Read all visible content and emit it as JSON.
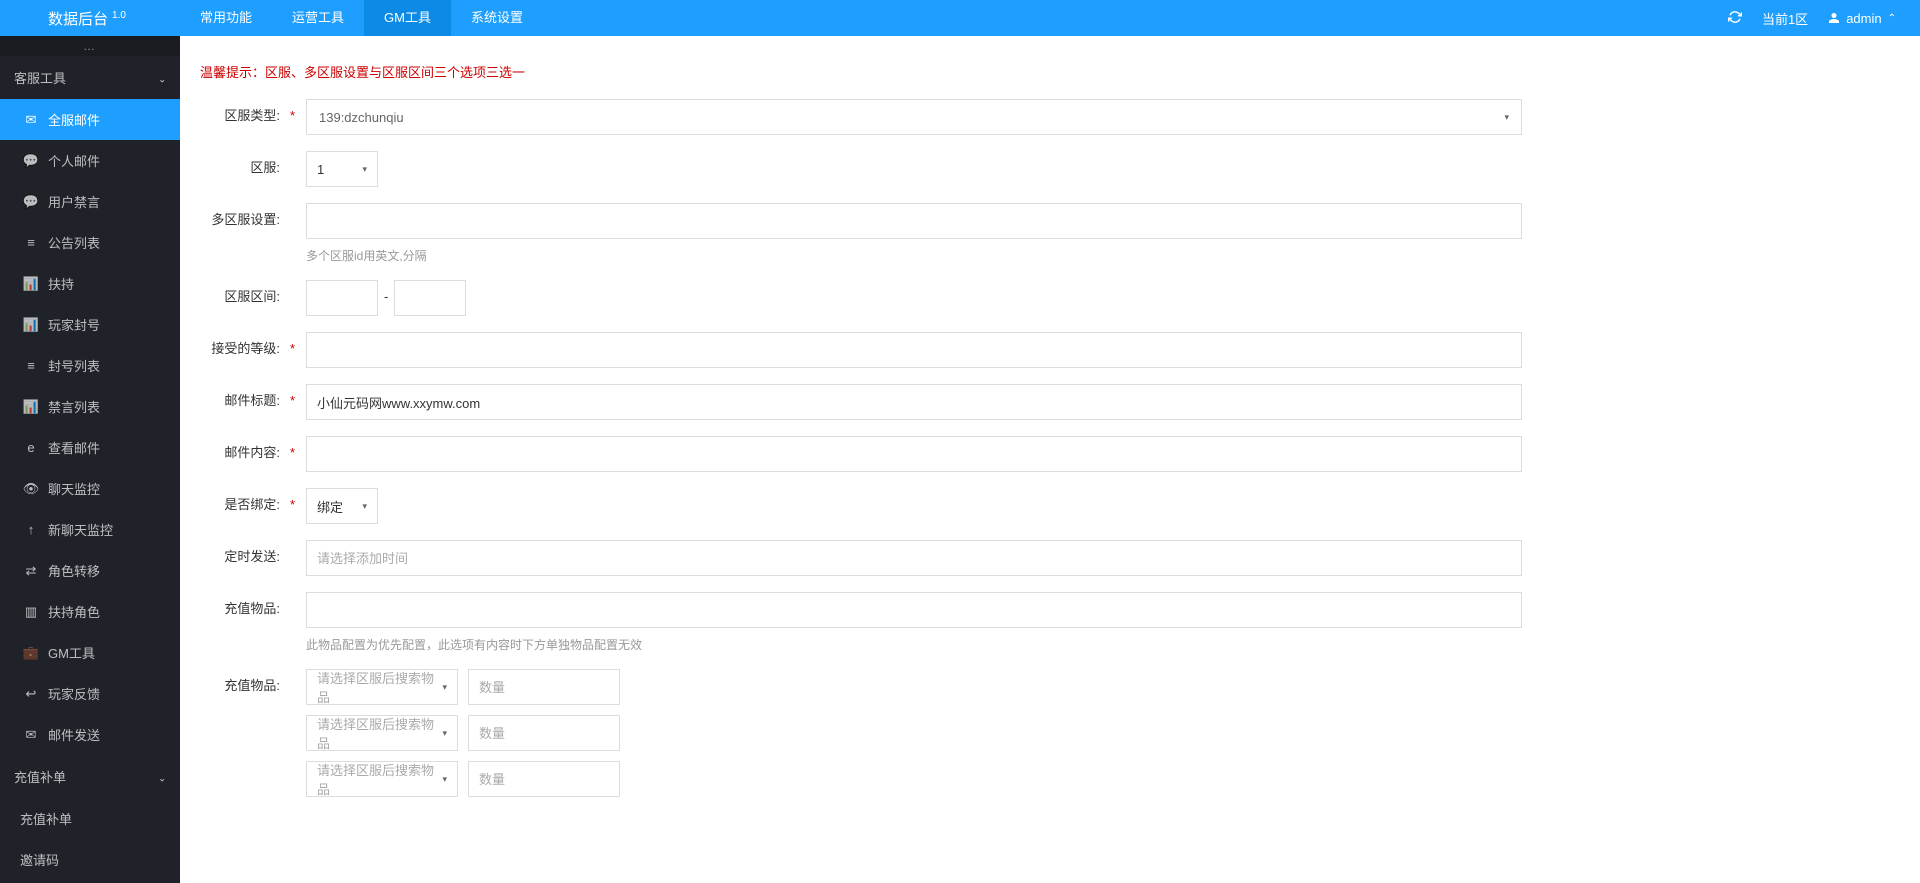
{
  "header": {
    "title": "数据后台",
    "version": "1.0",
    "nav": [
      "常用功能",
      "运营工具",
      "GM工具",
      "系统设置"
    ],
    "active_nav": 2,
    "current_zone_label": "当前1区",
    "user": "admin"
  },
  "sidebar": {
    "collapse_dots": "…",
    "groups": [
      {
        "title": "客服工具",
        "expanded": true,
        "items": [
          {
            "icon": "✉",
            "label": "全服邮件",
            "active": true
          },
          {
            "icon": "💬",
            "label": "个人邮件"
          },
          {
            "icon": "💬",
            "label": "用户禁言"
          },
          {
            "icon": "≡",
            "label": "公告列表"
          },
          {
            "icon": "📊",
            "label": "扶持"
          },
          {
            "icon": "📊",
            "label": "玩家封号"
          },
          {
            "icon": "≡",
            "label": "封号列表"
          },
          {
            "icon": "📊",
            "label": "禁言列表"
          },
          {
            "icon": "e",
            "label": "查看邮件"
          },
          {
            "icon": "👁",
            "label": "聊天监控"
          },
          {
            "icon": "↑",
            "label": "新聊天监控"
          },
          {
            "icon": "⇄",
            "label": "角色转移"
          },
          {
            "icon": "▥",
            "label": "扶持角色"
          },
          {
            "icon": "💼",
            "label": "GM工具"
          },
          {
            "icon": "↩",
            "label": "玩家反馈"
          },
          {
            "icon": "✉",
            "label": "邮件发送"
          }
        ]
      },
      {
        "title": "充值补单",
        "expanded": false,
        "items": [
          {
            "label": "充值补单"
          },
          {
            "label": "邀请码"
          }
        ]
      }
    ]
  },
  "form": {
    "warning": "温馨提示：区服、多区服设置与区服区间三个选项三选一",
    "server_type": {
      "label": "区服类型:",
      "value": "139:dzchunqiu"
    },
    "server": {
      "label": "区服:",
      "value": "1"
    },
    "multi_server": {
      "label": "多区服设置:",
      "hint": "多个区服id用英文,分隔"
    },
    "server_range": {
      "label": "区服区间:",
      "sep": "-"
    },
    "accept_level": {
      "label": "接受的等级:"
    },
    "mail_title": {
      "label": "邮件标题:",
      "value": "小仙元码网www.xxymw.com"
    },
    "mail_content": {
      "label": "邮件内容:"
    },
    "is_bind": {
      "label": "是否绑定:",
      "value": "绑定"
    },
    "schedule": {
      "label": "定时发送:",
      "placeholder": "请选择添加时间"
    },
    "recharge_item_cfg": {
      "label": "充值物品:",
      "hint": "此物品配置为优先配置，此选项有内容时下方单独物品配置无效"
    },
    "recharge_items": {
      "label": "充值物品:",
      "item_placeholder": "请选择区服后搜索物品",
      "qty_placeholder": "数量",
      "rows": 3
    }
  }
}
